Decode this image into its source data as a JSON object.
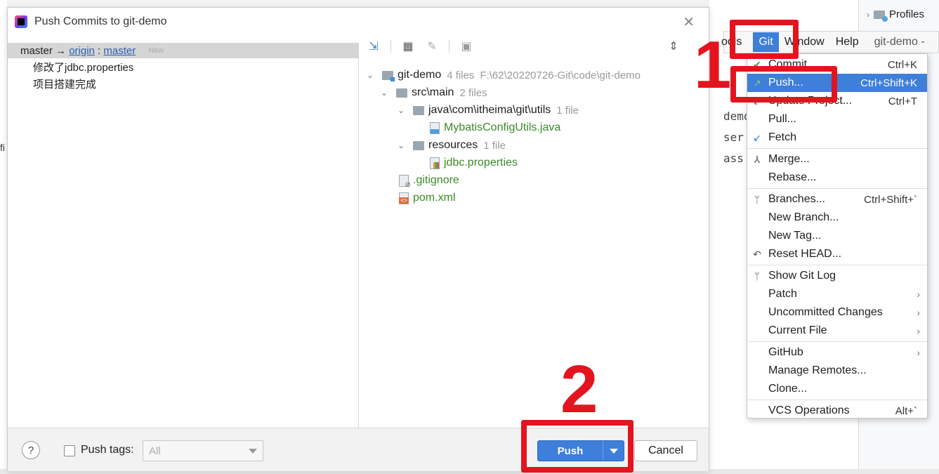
{
  "dialog": {
    "title": "Push Commits to git-demo",
    "branch": {
      "local": "master",
      "arrow": "→",
      "remote": "origin",
      "separator": ":",
      "remote_branch": "master",
      "badge": "New"
    },
    "commits": [
      "修改了jdbc.properties",
      "项目搭建完成"
    ],
    "tree": {
      "root": {
        "label": "git-demo",
        "count": "4 files",
        "path": "F:\\62\\20220726-Git\\code\\git-demo"
      },
      "src_main": {
        "label": "src\\main",
        "count": "2 files"
      },
      "java_pkg": {
        "label": "java\\com\\itheima\\git\\utils",
        "count": "1 file"
      },
      "java_file": "MybatisConfigUtils.java",
      "resources": {
        "label": "resources",
        "count": "1 file"
      },
      "props_file": "jdbc.properties",
      "gitignore": ".gitignore",
      "pom": "pom.xml"
    },
    "footer": {
      "help": "?",
      "push_tags_label": "Push tags:",
      "push_tags_select": "All",
      "push_button": "Push",
      "cancel_button": "Cancel"
    }
  },
  "menubar": {
    "tools": "ools",
    "git": "Git",
    "window": "Window",
    "help": "Help",
    "project": "git-demo -"
  },
  "git_menu": [
    {
      "label": "Commit...",
      "shortcut": "Ctrl+K",
      "icon": "check-icon"
    },
    {
      "label": "Push...",
      "shortcut": "Ctrl+Shift+K",
      "icon": "push-arrow-icon",
      "highlight": true
    },
    {
      "label": "Update Project...",
      "shortcut": "Ctrl+T",
      "icon": "update-icon"
    },
    {
      "label": "Pull...",
      "shortcut": ""
    },
    {
      "label": "Fetch",
      "shortcut": "",
      "icon": "fetch-icon"
    },
    {
      "label": "Merge...",
      "shortcut": "",
      "icon": "merge-icon"
    },
    {
      "label": "Rebase...",
      "shortcut": ""
    },
    {
      "label": "Branches...",
      "shortcut": "Ctrl+Shift+`",
      "icon": "branch-icon"
    },
    {
      "label": "New Branch...",
      "shortcut": ""
    },
    {
      "label": "New Tag...",
      "shortcut": ""
    },
    {
      "label": "Reset HEAD...",
      "shortcut": "",
      "icon": "reset-icon"
    },
    {
      "label": "Show Git Log",
      "shortcut": "",
      "icon": "git-log-icon"
    },
    {
      "label": "Patch",
      "submenu": true
    },
    {
      "label": "Uncommitted Changes",
      "submenu": true
    },
    {
      "label": "Current File",
      "submenu": true
    },
    {
      "label": "GitHub",
      "submenu": true
    },
    {
      "label": "Manage Remotes...",
      "shortcut": ""
    },
    {
      "label": "Clone...",
      "shortcut": ""
    },
    {
      "label": "VCS Operations",
      "shortcut": "Alt+`"
    }
  ],
  "ide": {
    "profiles": "Profiles",
    "editor_lines": [
      "demo",
      "ser",
      "ass"
    ],
    "side_fragment": "fi"
  },
  "annotations": {
    "step1": "1",
    "step2": "2",
    "color": "#e4141e"
  }
}
